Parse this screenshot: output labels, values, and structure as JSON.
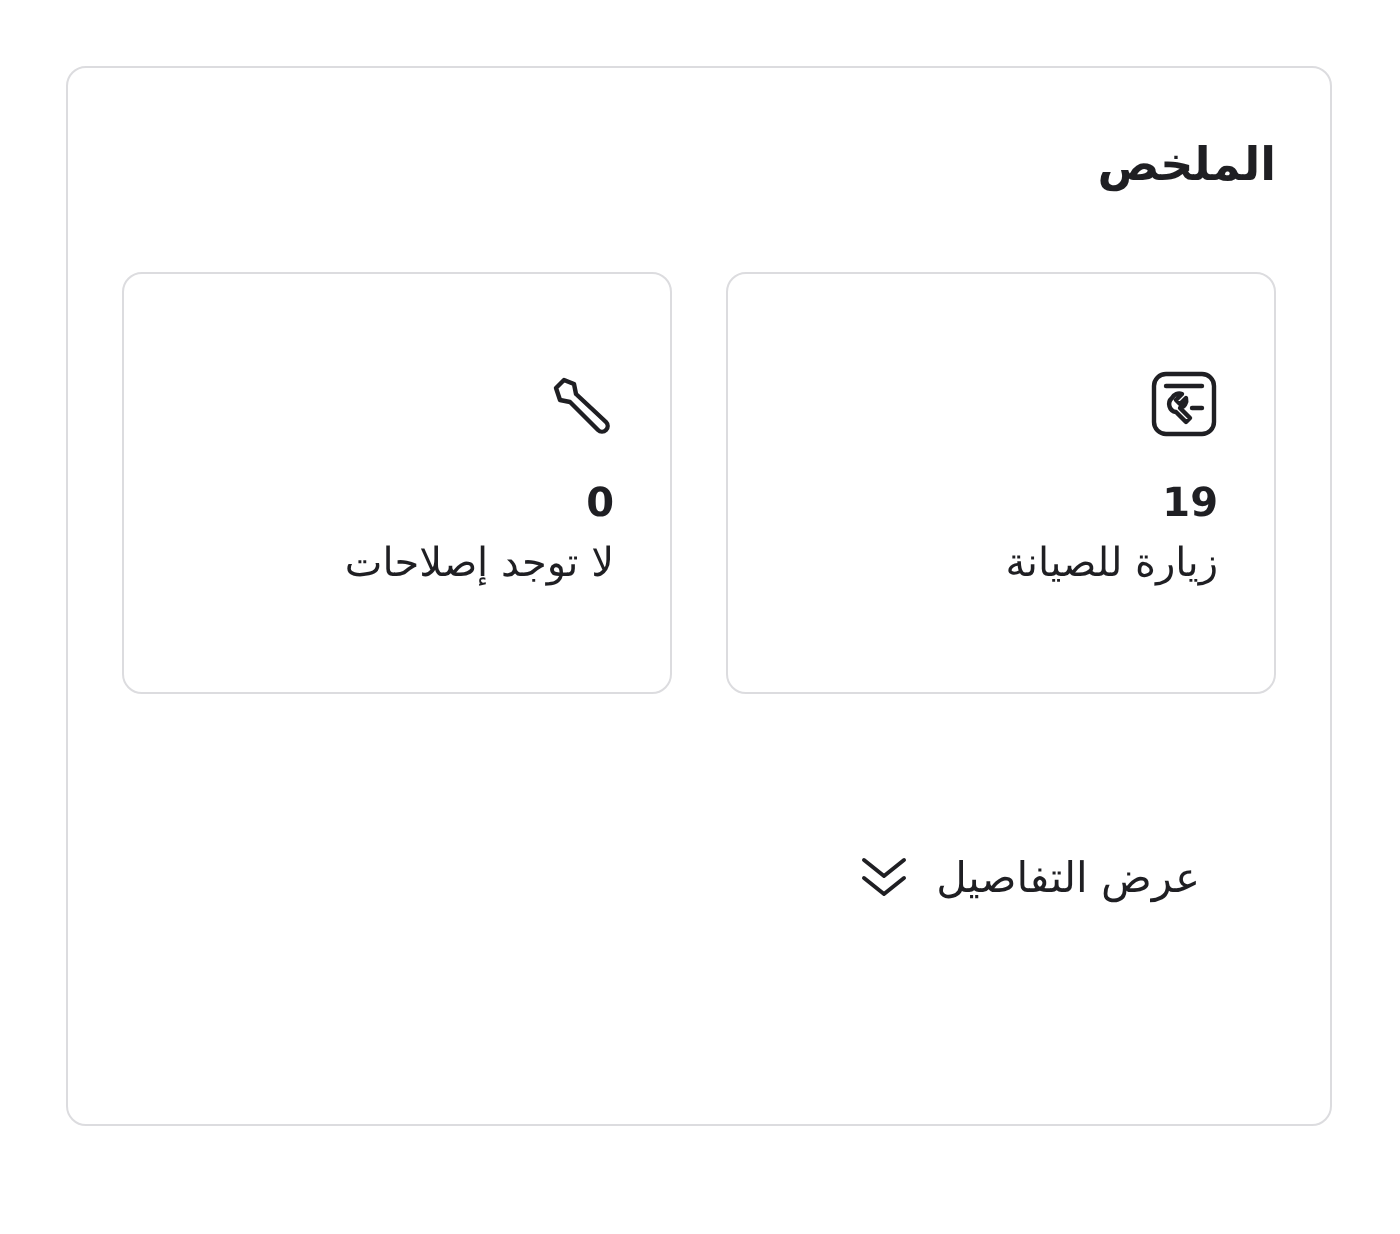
{
  "summary": {
    "title": "الملخص",
    "cards": [
      {
        "kind": "maintenance",
        "count": "19",
        "label": "زيارة للصيانة"
      },
      {
        "kind": "repairs",
        "count": "0",
        "label": "لا توجد إصلاحات"
      }
    ],
    "details_link": "عرض التفاصيل"
  }
}
